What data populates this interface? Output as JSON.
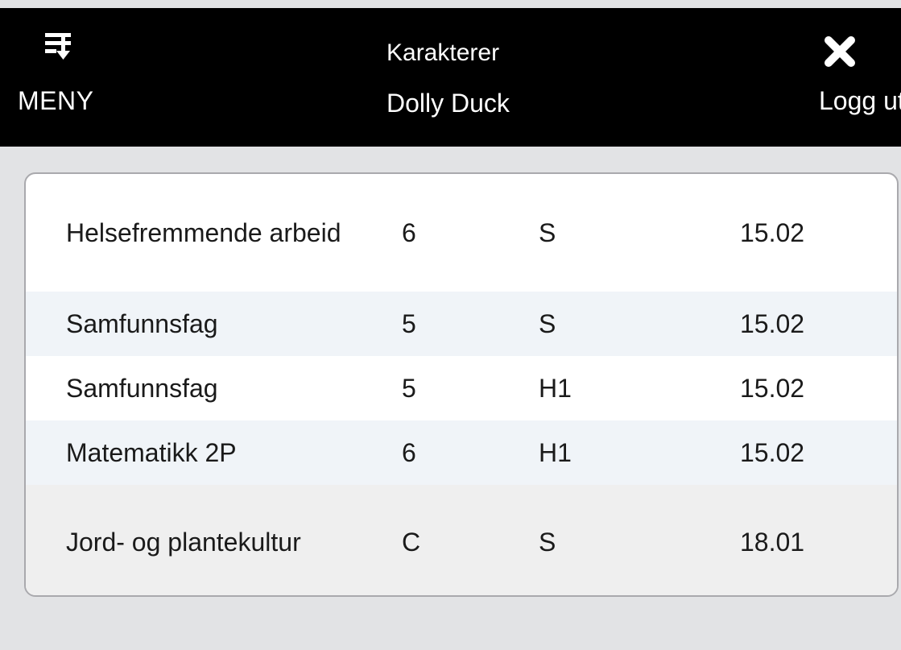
{
  "header": {
    "menu_label": "MENY",
    "title": "Karakterer",
    "student_name": "Dolly Duck",
    "logout_label": "Logg ut",
    "menu_icon": "menu-list-icon",
    "logout_icon": "close-icon"
  },
  "grades": {
    "rows": [
      {
        "subject": "Helsefremmende arbeid",
        "grade": "6",
        "term": "S",
        "date": "15.02"
      },
      {
        "subject": "Samfunnsfag",
        "grade": "5",
        "term": "S",
        "date": "15.02"
      },
      {
        "subject": "Samfunnsfag",
        "grade": "5",
        "term": "H1",
        "date": "15.02"
      },
      {
        "subject": "Matematikk 2P",
        "grade": "6",
        "term": "H1",
        "date": "15.02"
      },
      {
        "subject": "Jord- og plantekultur",
        "grade": "C",
        "term": "S",
        "date": "18.01"
      }
    ]
  },
  "colors": {
    "header_background": "#000000",
    "page_background": "#e2e3e5",
    "row_alt": "#f0f4f8",
    "row_highlight": "#efefef"
  }
}
